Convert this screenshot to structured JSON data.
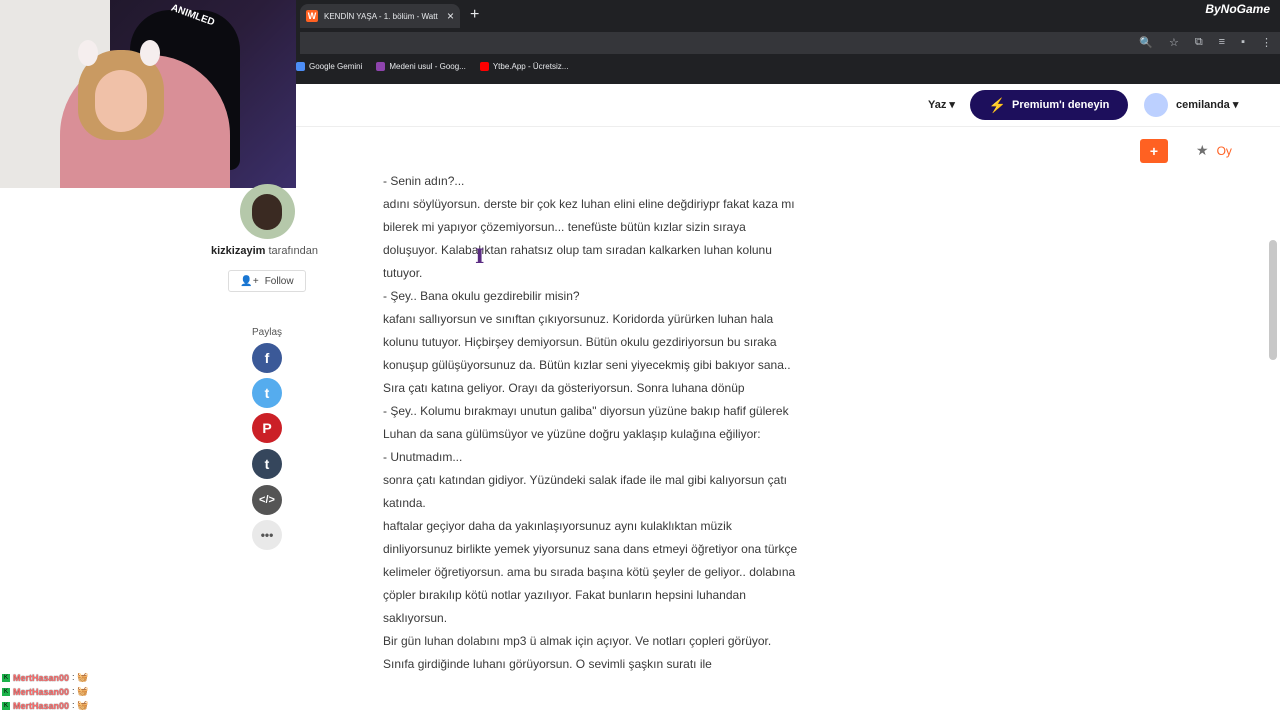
{
  "browser": {
    "tab_title": "KENDİN YAŞA - 1. bölüm - Watt",
    "tab_favicon": "W",
    "bookmarks": [
      {
        "label": "Google Gemini",
        "color": "#4c8df6"
      },
      {
        "label": "Medeni usul - Goog...",
        "color": "#8e44ad"
      },
      {
        "label": "Ytbe.App - Ücretsiz...",
        "color": "#ff0000"
      }
    ],
    "watermark": "ByNoGame"
  },
  "webcam": {
    "sign_text": "ANIMLED"
  },
  "header": {
    "write_label": "Yaz ▾",
    "premium_label": "Premium'ı deneyin",
    "username": "cemilanda ▾",
    "add_button": "+",
    "vote_label": "Oy"
  },
  "author": {
    "name": "kizkizayim",
    "by_text": "tarafından",
    "follow_label": "Follow"
  },
  "share": {
    "label": "Paylaş",
    "items": [
      {
        "name": "facebook",
        "glyph": "f",
        "color": "#3b5998"
      },
      {
        "name": "twitter",
        "glyph": "t",
        "color": "#55acee"
      },
      {
        "name": "pinterest",
        "glyph": "P",
        "color": "#cb2027"
      },
      {
        "name": "tumblr",
        "glyph": "t",
        "color": "#35465c"
      },
      {
        "name": "embed",
        "glyph": "</>",
        "color": "#555555"
      },
      {
        "name": "more",
        "glyph": "•••",
        "color": "#e9e9e9"
      }
    ]
  },
  "chat": [
    {
      "user": "MertHasan00",
      "msg": ": 🧺"
    },
    {
      "user": "MertHasan00",
      "msg": ": 🧺"
    },
    {
      "user": "MertHasan00",
      "msg": ": 🧺"
    }
  ],
  "story": {
    "paragraphs": [
      "- Senin adın?...",
      "adını söylüyorsun. derste bir çok kez luhan elini eline değdiriypr fakat kaza mı bilerek mi yapıyor çözemiyorsun... tenefüste bütün kızlar sizin sıraya doluşuyor. Kalabalıktan rahatsız olup tam sıradan kalkarken luhan kolunu tutuyor.",
      "- Şey.. Bana okulu gezdirebilir misin?",
      "kafanı sallıyorsun ve sınıftan çıkıyorsunuz. Koridorda yürürken luhan hala kolunu tutuyor. Hiçbirşey demiyorsun. Bütün okulu gezdiriyorsun bu sıraka konuşup gülüşüyorsunuz da. Bütün kızlar seni yiyecekmiş gibi bakıyor sana.. Sıra çatı katına geliyor. Orayı da gösteriyorsun. Sonra luhana dönüp",
      "- Şey.. Kolumu bırakmayı unutun galiba\" diyorsun yüzüne bakıp hafif gülerek Luhan da sana gülümsüyor ve yüzüne doğru yaklaşıp kulağına eğiliyor:",
      "- Unutmadım...",
      "sonra çatı katından gidiyor. Yüzündeki salak ifade ile mal gibi kalıyorsun çatı katında.",
      "haftalar geçiyor daha da yakınlaşıyorsunuz aynı kulaklıktan müzik dinliyorsunuz birlikte yemek yiyorsunuz sana dans etmeyi öğretiyor ona türkçe kelimeler öğretiyorsun. ama bu sırada başına kötü şeyler de geliyor.. dolabına çöpler bırakılıp kötü notlar yazılıyor. Fakat bunların hepsini luhandan saklıyorsun.",
      "Bir gün luhan dolabını mp3 ü almak için açıyor. Ve notları çopleri görüyor. Sınıfa girdiğinde luhanı görüyorsun. O sevimli şaşkın suratı ile"
    ]
  }
}
